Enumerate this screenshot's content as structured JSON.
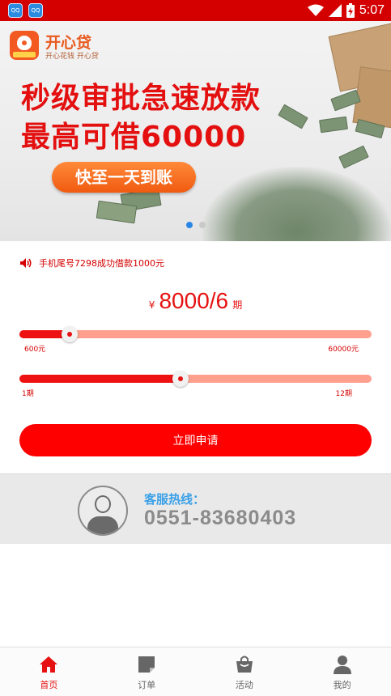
{
  "status_bar": {
    "app_icon_1": "QQ",
    "app_icon_2": "QQ",
    "time": "5:07",
    "icons": [
      "wifi-icon",
      "signal-icon",
      "battery-charging-icon"
    ]
  },
  "banner": {
    "logo_name": "开心贷",
    "logo_slogan": "开心花钱 开心贷",
    "headline_line1": "秒级审批急速放款",
    "headline_line2": "最高可借60000",
    "cta": "快至一天到账",
    "slide_count": 2,
    "active_slide": 0
  },
  "notice": {
    "icon": "speaker-icon",
    "text": "手机尾号7298成功借款1000元"
  },
  "loan": {
    "currency": "¥",
    "amount_term": "8000/6",
    "unit": "期",
    "amount_slider": {
      "min_label": "600元",
      "max_label": "60000元",
      "min": 600,
      "max": 60000,
      "value": 8000
    },
    "term_slider": {
      "min_label": "1期",
      "max_label": "12期",
      "min": 1,
      "max": 12,
      "value": 6
    },
    "apply_button": "立即申请"
  },
  "hotline": {
    "label": "客服热线：",
    "number": "0551-83680403",
    "icon": "customer-service-agent-icon"
  },
  "bottom_nav": [
    {
      "label": "首页",
      "icon": "home-icon",
      "active": true
    },
    {
      "label": "订单",
      "icon": "order-icon",
      "active": false
    },
    {
      "label": "活动",
      "icon": "activity-bag-icon",
      "active": false
    },
    {
      "label": "我的",
      "icon": "profile-icon",
      "active": false
    }
  ],
  "colors": {
    "status_bar": "#d40000",
    "primary_red": "#ff0000",
    "slider_track": "#ff9f8e",
    "hotline_blue": "#3aa0e8",
    "orange": "#f05a10"
  }
}
